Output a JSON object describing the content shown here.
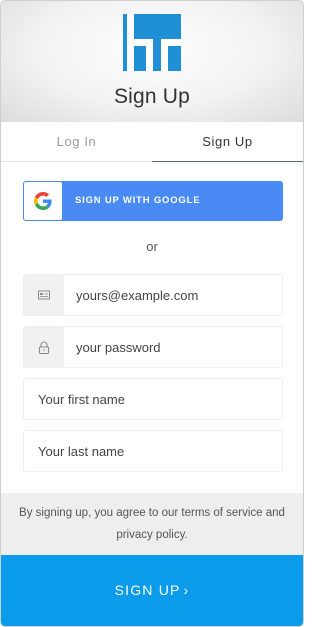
{
  "header": {
    "logo_name": "hr-logo",
    "title": "Sign Up"
  },
  "tabs": [
    {
      "label": "Log In",
      "active": false
    },
    {
      "label": "Sign Up",
      "active": true
    }
  ],
  "google": {
    "label": "SIGN UP WITH GOOGLE",
    "icon": "google-icon",
    "color": "#4a8af4"
  },
  "divider_text": "or",
  "fields": {
    "email": {
      "placeholder": "yours@example.com",
      "value": "",
      "icon": "envelope-icon"
    },
    "password": {
      "placeholder": "your password",
      "value": "",
      "icon": "lock-icon"
    },
    "first_name": {
      "placeholder": "Your first name",
      "value": ""
    },
    "last_name": {
      "placeholder": "Your last name",
      "value": ""
    }
  },
  "terms": {
    "text": "By signing up, you agree to our terms of service and privacy policy."
  },
  "submit": {
    "label": "SIGN UP",
    "chevron": "›",
    "color": "#0a9bea"
  }
}
